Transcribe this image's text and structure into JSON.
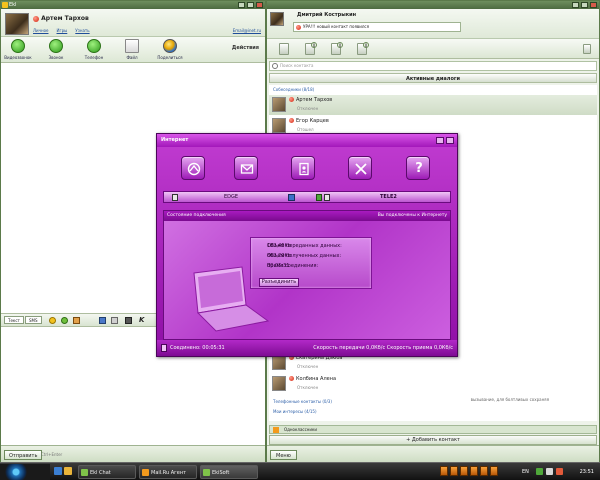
{
  "left_window": {
    "title": "Ekl",
    "contact": {
      "name": "Артем Тархов",
      "links": [
        "Личное",
        "Игры",
        "Узнать"
      ],
      "email": "Email@inet.ru"
    },
    "toolbar": [
      {
        "label": "Видеозвонок",
        "icon": "video-call-icon"
      },
      {
        "label": "Звонок",
        "icon": "phone-icon"
      },
      {
        "label": "Телефон",
        "icon": "mobile-phone-icon"
      },
      {
        "label": "Файл",
        "icon": "file-icon"
      },
      {
        "label": "Поделиться",
        "icon": "globe-icon"
      }
    ],
    "actions_label": "Действия",
    "format_modes": [
      "Текст",
      "SMS"
    ],
    "send_button": "Отправить",
    "send_option": "Ctrl+Enter"
  },
  "right_window": {
    "user_name": "Дмитрий Кострыкин",
    "status_text": "УРА!!! новый контакт появился",
    "toolbar_badges": [
      "0",
      "0",
      "0"
    ],
    "search_placeholder": "Поиск контакта",
    "group_header": "Активные диалоги",
    "groups": [
      {
        "label": "Собеседники (8/18)"
      },
      {
        "label": "Телефонные контакты (0/3)"
      },
      {
        "label": "Мои интересы (4/15)"
      }
    ],
    "contacts": [
      {
        "name": "Артем Тархов",
        "status": "Отключен",
        "selected": true
      },
      {
        "name": "Егор Карцев",
        "status": "Отошел",
        "selected": false
      },
      {
        "name": "Екатерина Дзюба",
        "status": "Отключен",
        "selected": false
      },
      {
        "name": "Колбина Алена",
        "status": "Отключен",
        "selected": false
      }
    ],
    "stray_text": "вызывание, для болтливых сохраняя",
    "bottom_group": "Одноклассники",
    "add_contact": "+ Добавить контакт",
    "menu_button": "Меню"
  },
  "internet_dialog": {
    "title": "Интернет",
    "icons": [
      "connect-globe-icon",
      "mail-icon",
      "contacts-book-icon",
      "tools-icon",
      "help-icon"
    ],
    "status_bar": [
      "EDGE",
      "TELE2"
    ],
    "panel_left": "Состояние подключения",
    "panel_right": "Вы подключены к Интернету",
    "stats": {
      "sent_label": "Объем переданных данных:",
      "sent_value": "182,45Kb",
      "recv_label": "Объем полученных данных:",
      "recv_value": "862,29Kb",
      "time_label": "Время соединения:",
      "time_value": "00:05:31"
    },
    "disconnect_button": "Разъединить",
    "footer_left": "Соединено: 00:05:31",
    "footer_right": "Скорость передачи 0,0Кб/с  Скорость приема 0,0Кб/с"
  },
  "taskbar": {
    "tasks": [
      "Ekl Chat",
      "Mail.Ru Агент",
      "EkiSoft"
    ],
    "language": "EN",
    "clock": "23:51"
  },
  "colors": {
    "dialog_purple": "#a318ba",
    "window_green": "#4d6b40",
    "status_red": "#d3230d"
  }
}
